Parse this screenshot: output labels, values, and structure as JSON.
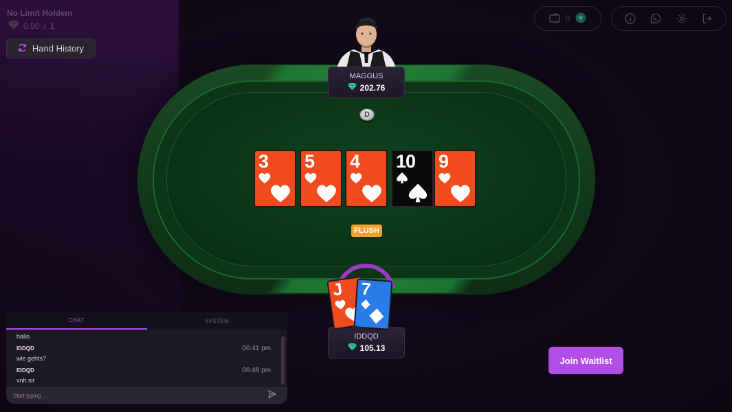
{
  "game": {
    "title": "No Limit Holdem",
    "stakes_small": "0.50",
    "stakes_sep": "/",
    "stakes_big": "1"
  },
  "buttons": {
    "hand_history": "Hand History",
    "join_waitlist": "Join Waitlist"
  },
  "wallet": {
    "balance": "0"
  },
  "top_icons": [
    "info-icon",
    "whatsapp-icon",
    "settings-icon",
    "exit-icon"
  ],
  "opponent": {
    "name": "MAGGUS",
    "stack": "202.76"
  },
  "player": {
    "name": "IDDQD",
    "stack": "105.13"
  },
  "dealer_button": "D",
  "board": [
    {
      "rank": "3",
      "suit": "hearts",
      "color": "red"
    },
    {
      "rank": "5",
      "suit": "hearts",
      "color": "red"
    },
    {
      "rank": "4",
      "suit": "hearts",
      "color": "red"
    },
    {
      "rank": "10",
      "suit": "spades",
      "color": "black"
    },
    {
      "rank": "9",
      "suit": "hearts",
      "color": "red"
    }
  ],
  "hole_cards": [
    {
      "rank": "J",
      "suit": "hearts",
      "color": "red"
    },
    {
      "rank": "7",
      "suit": "diamonds",
      "color": "blue"
    }
  ],
  "hand_strength": "FLUSH",
  "chat": {
    "tabs": [
      "CHAT",
      "SYSTEM"
    ],
    "active_tab": "CHAT",
    "messages": [
      {
        "user": "",
        "text": "hallo",
        "time": ""
      },
      {
        "user": "IDDQD",
        "text": "wie gehts?",
        "time": "06:41 pm"
      },
      {
        "user": "IDDQD",
        "text": "vnh sir",
        "time": "06:48 pm"
      }
    ],
    "input_placeholder": "Start typing ..."
  },
  "colors": {
    "accent": "#b24ee6",
    "card_red": "#f04a1f",
    "card_blue": "#2a7ae8",
    "felt": "#0b3618",
    "hand_badge": "#f4a02a"
  }
}
